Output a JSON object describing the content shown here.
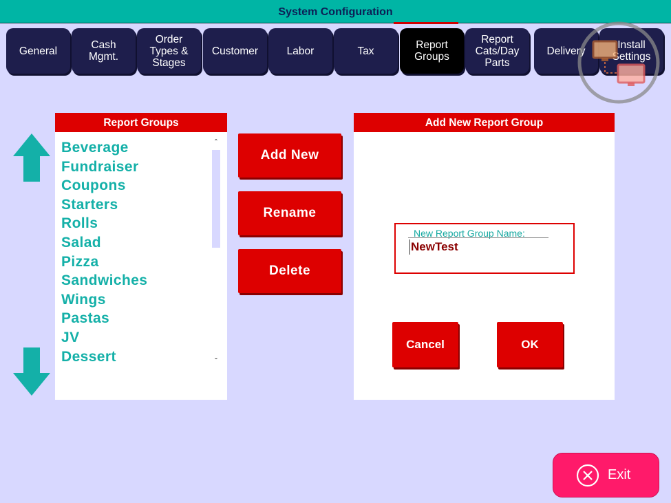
{
  "window": {
    "title": "System Configuration"
  },
  "tabs": [
    {
      "label": "General"
    },
    {
      "label": "Cash\nMgmt."
    },
    {
      "label": "Order\nTypes &\nStages"
    },
    {
      "label": "Customer"
    },
    {
      "label": "Labor"
    },
    {
      "label": "Tax"
    },
    {
      "label": "Report\nGroups",
      "active": true
    },
    {
      "label": "Report\nCats/Day\nParts"
    },
    {
      "label": "Delivery"
    },
    {
      "label": "Install\nSettings"
    }
  ],
  "report_groups": {
    "title": "Report Groups",
    "items": [
      "Beverage",
      "Fundraiser",
      "Coupons",
      "Starters",
      "Rolls",
      "Salad",
      "Pizza",
      "Sandwiches",
      "Wings",
      "Pastas",
      "JV",
      "Dessert"
    ]
  },
  "actions": {
    "add_new": "Add New",
    "rename": "Rename",
    "delete": "Delete"
  },
  "add_group": {
    "title": "Add New Report Group",
    "field_label": "New Report Group Name:",
    "field_value": "NewTest",
    "cancel": "Cancel",
    "ok": "OK"
  },
  "exit": {
    "label": "Exit"
  },
  "colors": {
    "accent_teal": "#00b5a5",
    "header_red": "#dd0000",
    "list_text": "#14b0a8",
    "tab_bg": "#1e1e4c",
    "exit_pink": "#ff1a6a",
    "page_bg": "#d8d8ff"
  },
  "icons": [
    "arrow-up-icon",
    "arrow-down-icon",
    "sync-computers-icon",
    "close-circle-icon",
    "scroll-up-icon",
    "scroll-down-icon"
  ]
}
